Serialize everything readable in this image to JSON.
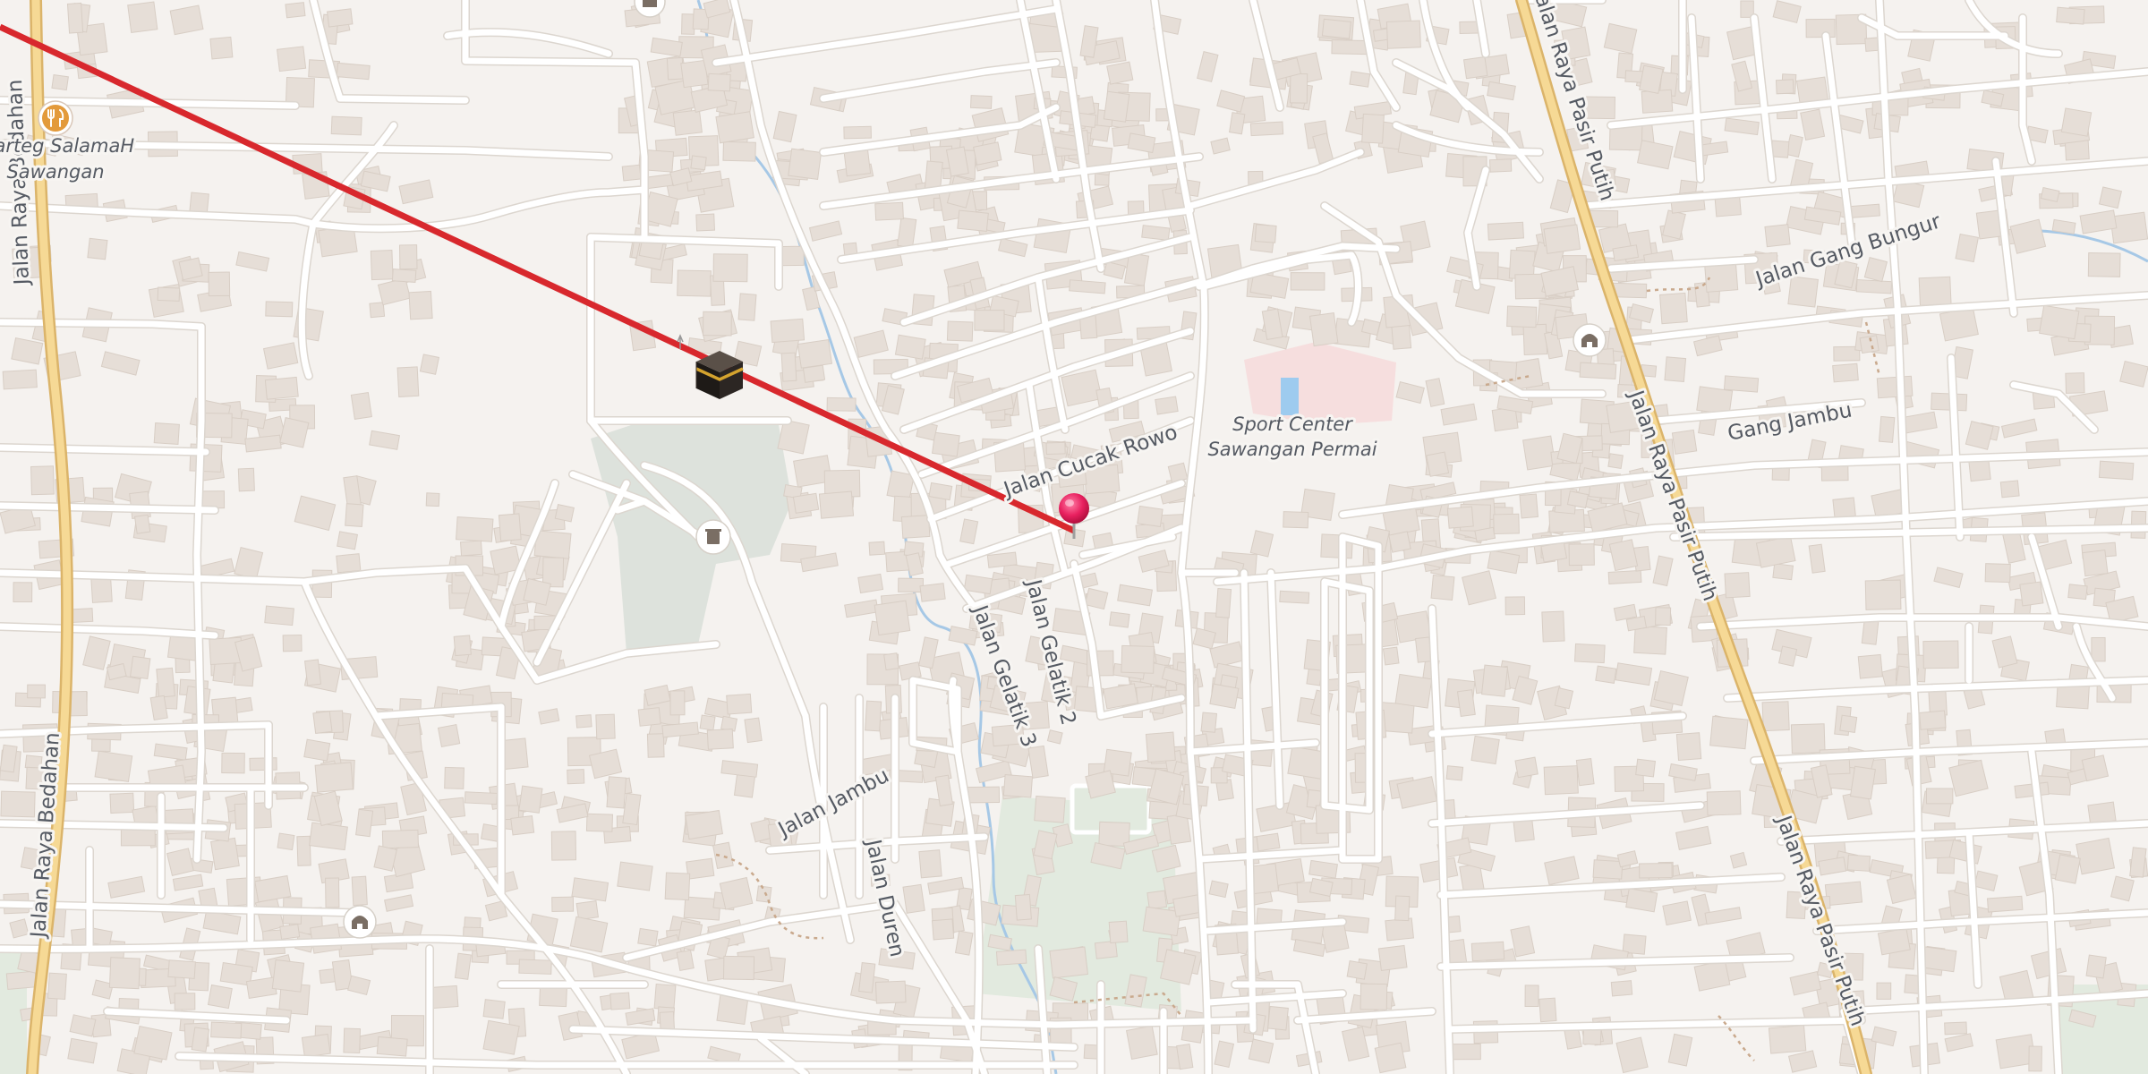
{
  "map": {
    "road_labels": {
      "bedahan_top": "Jalan Raya Bedahan",
      "bedahan_bottom": "Jalan Raya Bedahan",
      "pasir_putih_top": "Jalan Raya Pasir Putih",
      "pasir_putih_mid": "Jalan Raya Pasir Putih",
      "pasir_putih_bottom": "Jalan Raya Pasir Putih",
      "gang_bungur": "Jalan Gang Bungur",
      "gang_jambu": "Gang Jambu",
      "cucak_rowo": "Jalan Cucak Rowo",
      "gelatik_2": "Jalan Gelatik 2",
      "gelatik_3": "Jalan Gelatik 3",
      "jambu": "Jalan Jambu",
      "duren": "Jalan Duren"
    },
    "poi_labels": {
      "warteg_line1": "Warteg SalamaH",
      "warteg_line2": "Sawangan",
      "sport_line1": "Sport Center",
      "sport_line2": "Sawangan Permai"
    },
    "icons": {
      "restaurant": "fork-knife-icon",
      "mosque": "mosque-icon",
      "kaaba": "kaaba-icon",
      "cemetery": "cemetery-icon",
      "pin": "map-pin-icon"
    },
    "colors": {
      "background": "#f5f2ef",
      "building": "#e6ded7",
      "road": "#ffffff",
      "road_casing": "#dcd6cf",
      "main_road": "#f6d995",
      "main_road_casing": "#dbb46a",
      "water": "#a6c8e6",
      "park": "#dfe8dc",
      "cemetery": "#d9e0d9",
      "sport_area": "#f7d9d9",
      "pool": "#9ecbef",
      "qibla_line": "#d8282d",
      "pin": "#e8205f",
      "label": "#555a63"
    }
  }
}
